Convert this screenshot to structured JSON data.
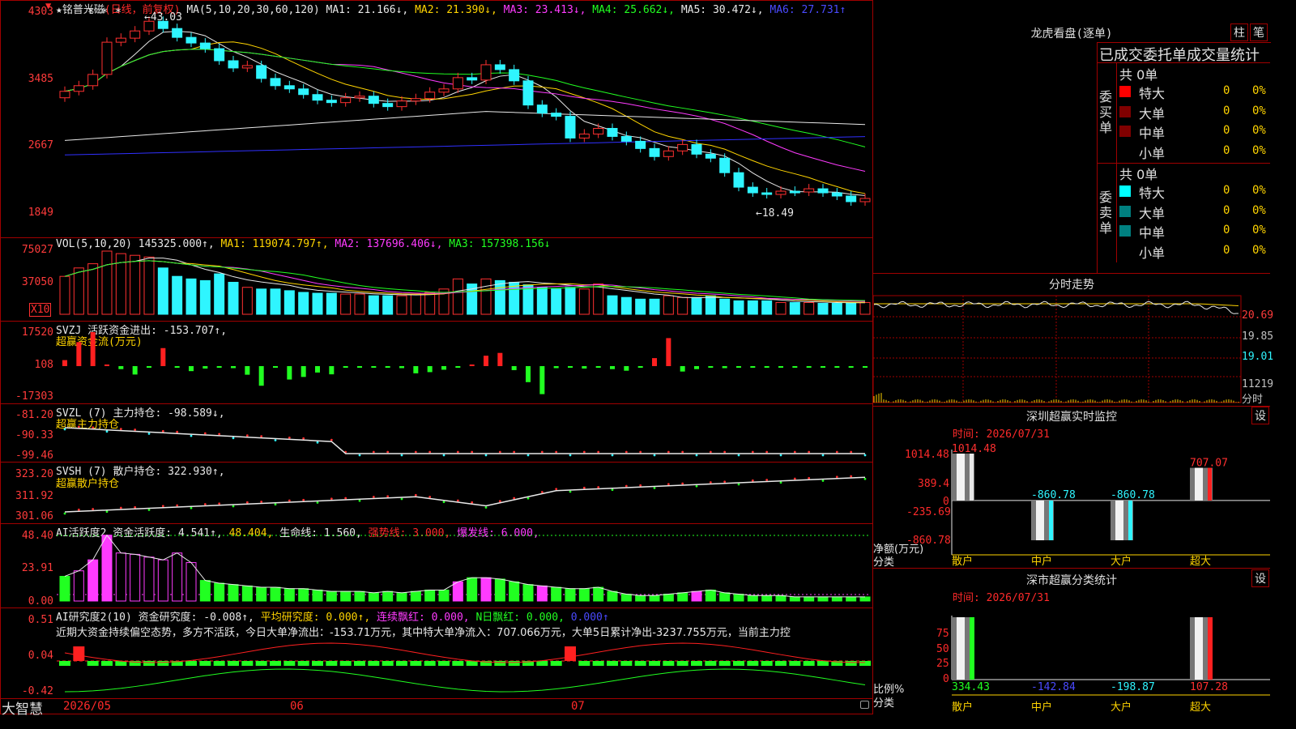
{
  "stock": {
    "title": "★铭普光磁",
    "period": "(日线，前复权)",
    "ma_label": "MA(5,10,20,30,60,120)",
    "ma1": "MA1: 21.166↓,",
    "ma2": "MA2: 21.390↓,",
    "ma3": "MA3: 23.413↓,",
    "ma4": "MA4: 25.662↓,",
    "ma5": "MA5: 30.472↓,",
    "ma6": "MA6: 27.731↑",
    "high_label": "←43.03",
    "low_label": "←18.49",
    "y_ticks": [
      "4303",
      "3485",
      "2667",
      "1849"
    ],
    "stars": "* * *"
  },
  "vol": {
    "header": "VOL(5,10,20)",
    "val": "145325.000↑,",
    "ma1": "MA1: 119074.797↑,",
    "ma2": "MA2: 137696.406↓,",
    "ma3": "MA3: 157398.156↓",
    "y_ticks": [
      "75027",
      "37050"
    ],
    "unit": "X10"
  },
  "svzj": {
    "header": "SVZJ  活跃资金进出: -153.707↑,",
    "sub": "超赢资金流(万元)",
    "y_ticks": [
      "17520",
      "108",
      "-17303"
    ]
  },
  "svzl": {
    "header": "SVZL (7) 主力持仓: -98.589↓,",
    "sub": "超赢主力持仓",
    "y_ticks": [
      "-81.20",
      "-90.33",
      "-99.46"
    ]
  },
  "svsh": {
    "header": "SVSH (7) 散户持仓: 322.930↑,",
    "sub": "超赢散户持仓",
    "y_ticks": [
      "323.20",
      "311.92",
      "301.06"
    ]
  },
  "ai_active": {
    "header_a": "AI活跃度2 资金活跃度: 4.541↑,",
    "header_b": "48.404,",
    "header_c": "生命线: 1.560,",
    "header_d": "强势线: 3.000,",
    "header_e": "爆发线: 6.000,",
    "y_ticks": [
      "48.40",
      "23.91",
      "0.00"
    ]
  },
  "ai_research": {
    "header_a": "AI研究度2(10) 资金研究度: -0.008↑,",
    "header_b": "平均研究度: 0.000↑,",
    "header_c": "连续飘红: 0.000,",
    "header_d": "N日飘红: 0.000,",
    "header_e": "0.000↑",
    "summary": "近期大资金持续偏空态势，多方不活跃，今日大单净流出：-153.71万元，其中特大单净流入：707.066万元，大单5日累计净出-3237.755万元，当前主力控",
    "y_ticks": [
      "0.51",
      "0.04",
      "-0.42"
    ]
  },
  "footer": {
    "brand": "大智慧",
    "dates": [
      "2026/05",
      "06",
      "07"
    ]
  },
  "dragon": {
    "title": "龙虎看盘(逐单)",
    "btn1": "柱",
    "btn2": "笔",
    "subtitle": "已成交委托单成交量统计",
    "buy_side": "委买单",
    "sell_side": "委卖单",
    "buy_total": "共 0单",
    "sell_total": "共 0单",
    "buy_rows": [
      {
        "label": "特大",
        "count": "0",
        "pct": "0%",
        "color": "#ff0000"
      },
      {
        "label": "大单",
        "count": "0",
        "pct": "0%",
        "color": "#800000"
      },
      {
        "label": "中单",
        "count": "0",
        "pct": "0%",
        "color": "#800000"
      },
      {
        "label": "小单",
        "count": "0",
        "pct": "0%",
        "color": "#000000"
      }
    ],
    "sell_rows": [
      {
        "label": "特大",
        "count": "0",
        "pct": "0%",
        "color": "#00ffff"
      },
      {
        "label": "大单",
        "count": "0",
        "pct": "0%",
        "color": "#008080"
      },
      {
        "label": "中单",
        "count": "0",
        "pct": "0%",
        "color": "#008080"
      },
      {
        "label": "小单",
        "count": "0",
        "pct": "0%",
        "color": "#000000"
      }
    ]
  },
  "intraday": {
    "title": "分时走势",
    "y_labels": [
      "20.69",
      "19.85",
      "19.01",
      "11219",
      "分时"
    ]
  },
  "monitor": {
    "title": "深圳超赢实时监控",
    "btn": "设",
    "time": "时间: 2026/07/31",
    "y_ticks": [
      "1014.48",
      "389.4",
      "0",
      "-235.69",
      "-860.78"
    ],
    "axis_title_a": "净额(万元)",
    "axis_title_b": "分类",
    "categories": [
      "散户",
      "中户",
      "大户",
      "超大"
    ],
    "values": [
      "1014.48",
      "-860.78",
      "-860.78",
      "707.07"
    ]
  },
  "classify": {
    "title": "深市超赢分类统计",
    "btn": "设",
    "time": "时间: 2026/07/31",
    "y_ticks": [
      "75",
      "50",
      "25",
      "0"
    ],
    "axis_title_a": "比例%",
    "axis_title_b": "分类",
    "categories": [
      "散户",
      "中户",
      "大户",
      "超大"
    ],
    "values": [
      "334.43",
      "-142.84",
      "-198.87",
      "107.28"
    ]
  },
  "chart_data": [
    {
      "type": "candlestick",
      "title": "★铭普光磁",
      "ylim": [
        18.49,
        43.03
      ],
      "note": "close estimates per day",
      "closes": [
        33.5,
        34.2,
        35.6,
        39.6,
        40.1,
        41.0,
        42.2,
        41.3,
        40.2,
        39.5,
        38.8,
        37.3,
        36.4,
        36.7,
        35.1,
        34.2,
        33.8,
        33.1,
        32.4,
        32.1,
        32.7,
        32.9,
        32.0,
        31.6,
        32.3,
        32.6,
        33.4,
        33.8,
        35.2,
        34.9,
        36.8,
        36.2,
        34.8,
        31.8,
        30.8,
        30.4,
        27.7,
        28.2,
        28.9,
        27.9,
        27.3,
        26.4,
        25.4,
        26.1,
        26.9,
        25.7,
        25.2,
        23.4,
        21.6,
        20.9,
        20.7,
        21.1,
        21.0,
        21.4,
        20.9,
        20.5,
        19.8,
        20.2
      ]
    },
    {
      "type": "bar",
      "title": "VOL(5,10,20)",
      "values": [
        45,
        55,
        60,
        75,
        72,
        70,
        68,
        55,
        45,
        42,
        40,
        48,
        38,
        32,
        30,
        30,
        28,
        26,
        25,
        25,
        24,
        24,
        22,
        22,
        22,
        24,
        26,
        30,
        42,
        36,
        42,
        40,
        38,
        35,
        32,
        30,
        32,
        30,
        36,
        22,
        20,
        18,
        18,
        22,
        20,
        20,
        22,
        18,
        16,
        16,
        16,
        14,
        14,
        14,
        13,
        13,
        14,
        14
      ],
      "ylim": [
        0,
        75027
      ]
    },
    {
      "type": "bar",
      "title": "超赢资金流(万元)",
      "values": [
        3000,
        12000,
        17000,
        200,
        -1500,
        -4200,
        -300,
        9000,
        -400,
        -2500,
        -1200,
        -800,
        -1000,
        -4300,
        -9800,
        -500,
        -6700,
        -5400,
        -3200,
        -4100,
        -700,
        -200,
        -300,
        -700,
        -1000,
        -3600,
        -3000,
        -1800,
        -500,
        800,
        5200,
        6600,
        -2000,
        -8000,
        -14000,
        -1000,
        -700,
        -1200,
        -600,
        -1500,
        -2300,
        -200,
        4000,
        14000,
        -2700,
        -1500,
        -800,
        -1000,
        -600,
        -500,
        -200,
        -300,
        -100,
        -200,
        -250,
        -200,
        -150,
        -150
      ],
      "ylim": [
        -17303,
        17520
      ]
    },
    {
      "type": "bar",
      "title": "AI活跃度2",
      "values": [
        18,
        22,
        30,
        48,
        35,
        34,
        32,
        30,
        35,
        28,
        15,
        13,
        12,
        11,
        10,
        10,
        9,
        9,
        8,
        7,
        7,
        7,
        6,
        7,
        6,
        7,
        8,
        8,
        14,
        17,
        17,
        16,
        14,
        12,
        11,
        10,
        9,
        9,
        10,
        7,
        5,
        4,
        4,
        5,
        6,
        7,
        8,
        6,
        5,
        4,
        4,
        4,
        3,
        3,
        3,
        3,
        3,
        3
      ],
      "ylim": [
        0,
        48.4
      ]
    },
    {
      "type": "bar",
      "title": "深圳超赢实时监控",
      "categories": [
        "散户",
        "中户",
        "大户",
        "超大"
      ],
      "values": [
        1014.48,
        -860.78,
        -860.78,
        707.07
      ],
      "ylim": [
        -860.78,
        1014.48
      ]
    },
    {
      "type": "bar",
      "title": "深市超赢分类统计",
      "categories": [
        "散户",
        "中户",
        "大户",
        "超大"
      ],
      "values": [
        334.43,
        -142.84,
        -198.87,
        107.28
      ]
    }
  ]
}
